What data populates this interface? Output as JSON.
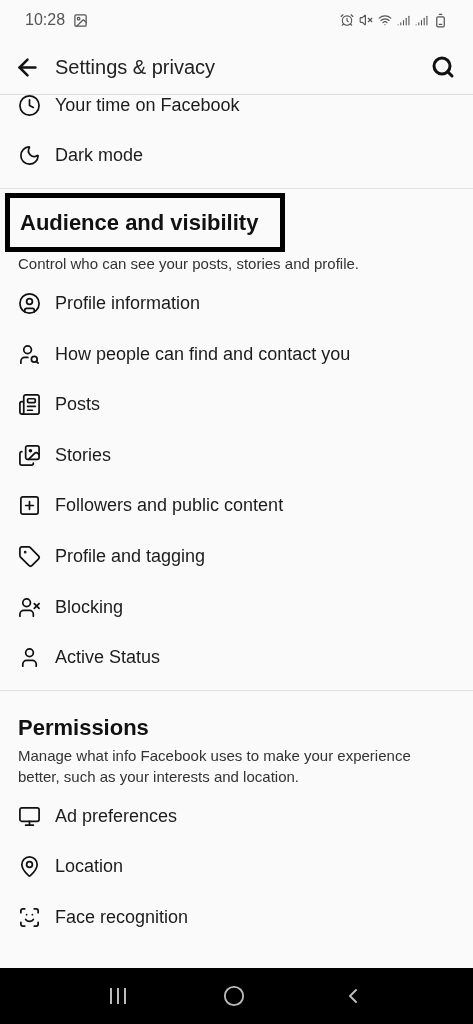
{
  "status_bar": {
    "time": "10:28"
  },
  "header": {
    "title": "Settings & privacy"
  },
  "top_items": [
    {
      "label": "Your time on Facebook",
      "kind": "clock"
    },
    {
      "label": "Dark mode",
      "kind": "moon"
    }
  ],
  "sections": [
    {
      "title": "Audience and visibility",
      "highlighted": true,
      "description": "Control who can see your posts, stories and profile.",
      "items": [
        {
          "label": "Profile information",
          "kind": "profile"
        },
        {
          "label": "How people can find and contact you",
          "kind": "find"
        },
        {
          "label": "Posts",
          "kind": "posts"
        },
        {
          "label": "Stories",
          "kind": "stories"
        },
        {
          "label": "Followers and public content",
          "kind": "followers"
        },
        {
          "label": "Profile and tagging",
          "kind": "tag"
        },
        {
          "label": "Blocking",
          "kind": "block"
        },
        {
          "label": "Active Status",
          "kind": "person"
        }
      ]
    },
    {
      "title": "Permissions",
      "highlighted": false,
      "description": "Manage what info Facebook uses to make your experience better, such as your interests and location.",
      "items": [
        {
          "label": "Ad preferences",
          "kind": "ads"
        },
        {
          "label": "Location",
          "kind": "location"
        },
        {
          "label": "Face recognition",
          "kind": "face"
        }
      ]
    }
  ]
}
